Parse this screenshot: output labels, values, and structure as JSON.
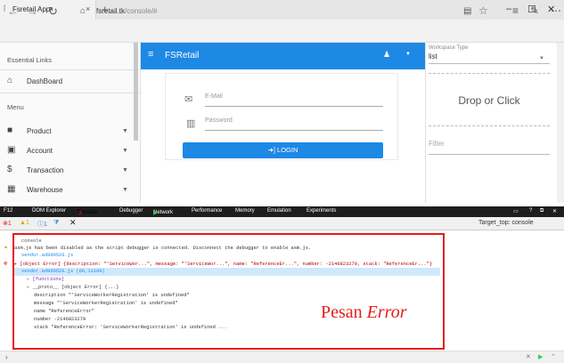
{
  "browser": {
    "tab_title": "Fsretail App",
    "tab_close": "×",
    "new_tab": "+",
    "url_host": "fsretail.tk",
    "url_path": "/console/#",
    "window_controls": [
      "–",
      "☐",
      "✕"
    ]
  },
  "sidebar": {
    "header": "Essential Links",
    "dashboard_label": "DashBoard",
    "menu_label": "Menu",
    "items": [
      {
        "label": "Product",
        "icon": "folder-icon"
      },
      {
        "label": "Account",
        "icon": "account-box-icon"
      },
      {
        "label": "Transaction",
        "icon": "dollar-icon"
      },
      {
        "label": "Warehouse",
        "icon": "warehouse-icon"
      }
    ]
  },
  "topbar": {
    "brand": "FSRetail"
  },
  "login": {
    "email_placeholder": "E-Mail",
    "password_placeholder": "Password",
    "button_label": "LOGIN"
  },
  "right_panel": {
    "workspace_label": "Workspace Type",
    "workspace_value": "list",
    "dropzone_text": "Drop or Click",
    "filter_placeholder": "Filter"
  },
  "devtools": {
    "tabs": [
      "F12",
      "DOM Explorer",
      "Console",
      "Debugger",
      "Network",
      "Performance",
      "Memory",
      "Emulation",
      "Experiments"
    ],
    "error_count": "1",
    "warning_count": "1",
    "info_count": "1",
    "target_label": "Target",
    "target_value": "_top: console"
  },
  "console_lines": [
    "console",
    "asm.js has been disabled as the script debugger is connected. Disconnect the debugger to enable asm.js.",
    "vendor.ad9d9526.js",
    "▸ [object Error]        {description: \"'ServiceWor...\", message: \"'ServiceWor...\", name: \"ReferenceEr...\", number: -2146823279, stack: \"ReferenceEr...\"}",
    "vendor.ad9d9526.js (66,11100)",
    "▹ [functions]",
    "▹ __proto__          [object Error] {...}",
    "description          \"'ServiceWorkerRegistration' is undefined\"",
    "message              \"'ServiceWorkerRegistration' is undefined\"",
    "name                 \"ReferenceError\"",
    "number               -2146823279",
    "stack                \"ReferenceError: 'ServiceWorkerRegistration' is undefined ..."
  ],
  "annotation": {
    "prefix": "Pesan ",
    "emphasis": "Error",
    "color": "#e51b1b"
  },
  "colors": {
    "accent": "#1e88e5",
    "error": "#e51b1b"
  }
}
